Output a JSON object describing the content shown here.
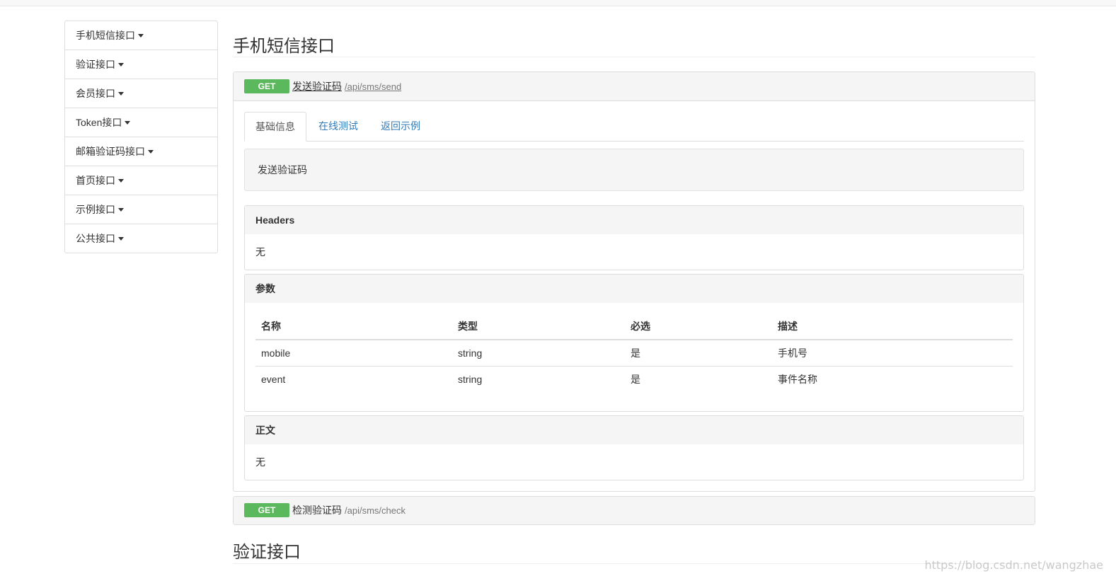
{
  "sidebar": {
    "items": [
      {
        "label": "手机短信接口"
      },
      {
        "label": "验证接口"
      },
      {
        "label": "会员接口"
      },
      {
        "label": "Token接口"
      },
      {
        "label": "邮箱验证码接口"
      },
      {
        "label": "首页接口"
      },
      {
        "label": "示例接口"
      },
      {
        "label": "公共接口"
      }
    ]
  },
  "main": {
    "section_title": "手机短信接口",
    "endpoints": [
      {
        "method": "GET",
        "name": "发送验证码",
        "path": "/api/sms/send",
        "tabs": [
          "基础信息",
          "在线测试",
          "返回示例"
        ],
        "description": "发送验证码",
        "headers": {
          "title": "Headers",
          "value": "无"
        },
        "params": {
          "title": "参数",
          "columns": [
            "名称",
            "类型",
            "必选",
            "描述"
          ],
          "rows": [
            [
              "mobile",
              "string",
              "是",
              "手机号"
            ],
            [
              "event",
              "string",
              "是",
              "事件名称"
            ]
          ]
        },
        "body": {
          "title": "正文",
          "value": "无"
        }
      },
      {
        "method": "GET",
        "name": "检测验证码",
        "path": "/api/sms/check"
      }
    ],
    "next_section_title": "验证接口"
  },
  "watermark": "https://blog.csdn.net/wangzhae",
  "colors": {
    "get_badge": "#5cb85c",
    "link": "#337ab7"
  }
}
